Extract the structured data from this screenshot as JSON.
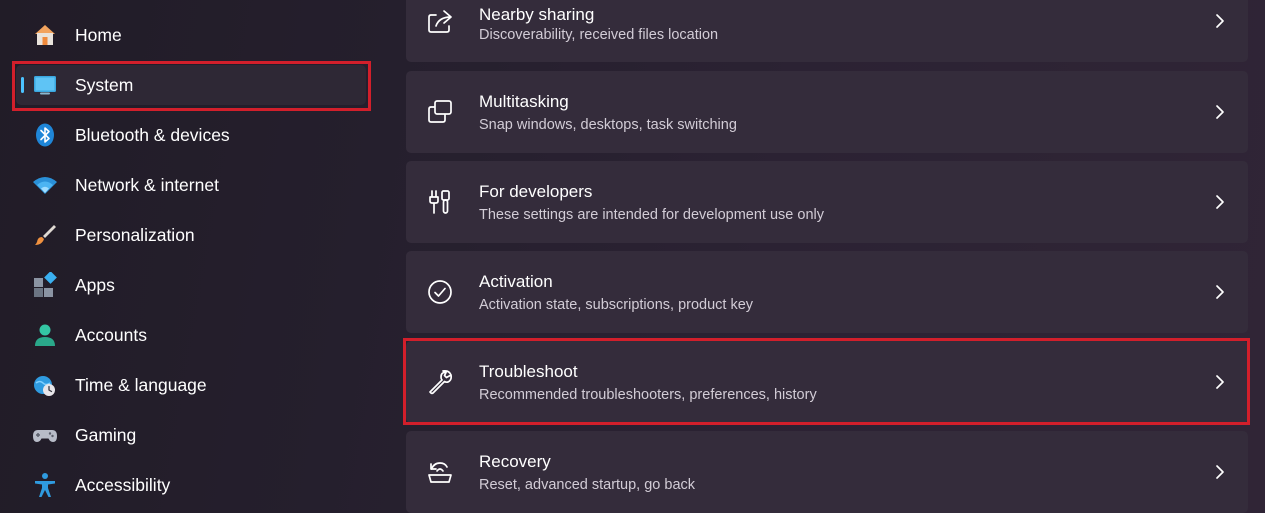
{
  "sidebar": {
    "items": [
      {
        "label": "Home",
        "icon": "home-icon"
      },
      {
        "label": "System",
        "icon": "monitor-icon",
        "selected": true
      },
      {
        "label": "Bluetooth & devices",
        "icon": "bluetooth-icon"
      },
      {
        "label": "Network & internet",
        "icon": "wifi-icon"
      },
      {
        "label": "Personalization",
        "icon": "paintbrush-icon"
      },
      {
        "label": "Apps",
        "icon": "apps-icon"
      },
      {
        "label": "Accounts",
        "icon": "person-icon"
      },
      {
        "label": "Time & language",
        "icon": "globe-clock-icon"
      },
      {
        "label": "Gaming",
        "icon": "gamepad-icon"
      },
      {
        "label": "Accessibility",
        "icon": "accessibility-icon"
      }
    ]
  },
  "main": {
    "cards": [
      {
        "title": "Nearby sharing",
        "subtitle": "Discoverability, received files location",
        "icon": "share-icon"
      },
      {
        "title": "Multitasking",
        "subtitle": "Snap windows, desktops, task switching",
        "icon": "multitasking-icon"
      },
      {
        "title": "For developers",
        "subtitle": "These settings are intended for development use only",
        "icon": "developer-tools-icon"
      },
      {
        "title": "Activation",
        "subtitle": "Activation state, subscriptions, product key",
        "icon": "checkmark-circle-icon"
      },
      {
        "title": "Troubleshoot",
        "subtitle": "Recommended troubleshooters, preferences, history",
        "icon": "wrench-icon"
      },
      {
        "title": "Recovery",
        "subtitle": "Reset, advanced startup, go back",
        "icon": "recovery-icon"
      }
    ]
  },
  "colors": {
    "accent": "#4cc2ff",
    "highlight": "#d21f2b",
    "card_background": "#342c3b"
  }
}
